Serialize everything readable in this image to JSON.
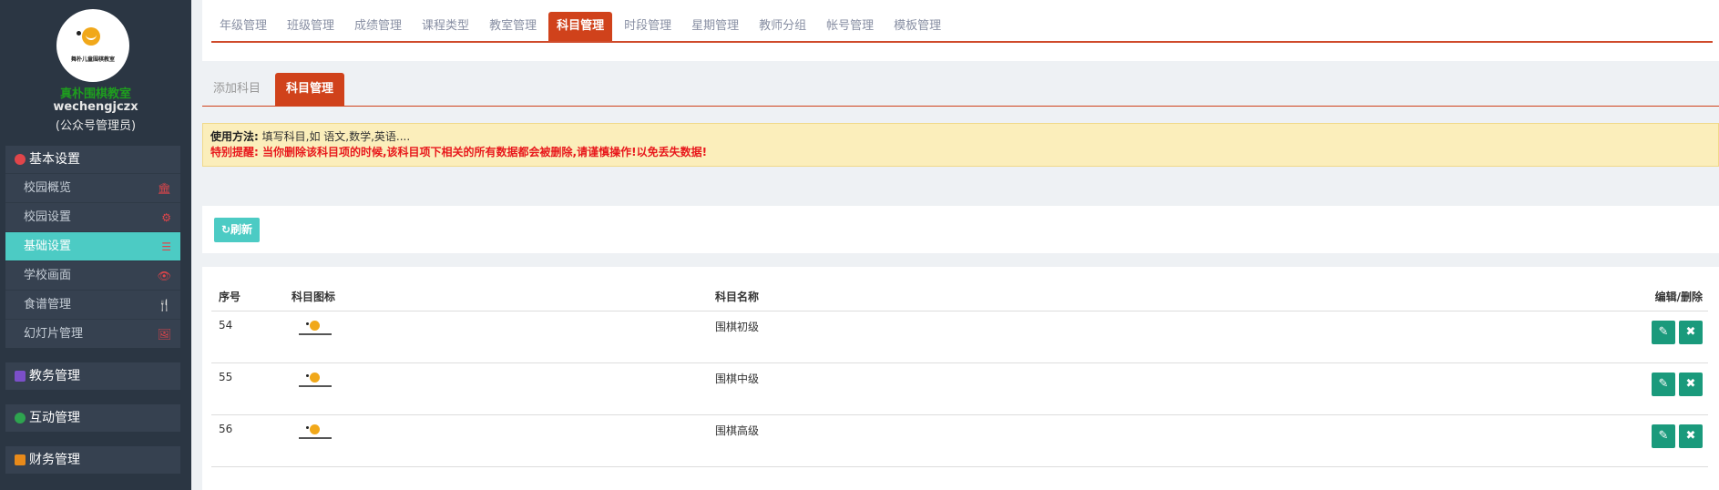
{
  "sidebar": {
    "profile": {
      "logo_text": "舞朴儿童围棋教室",
      "school_name": "真朴围棋教室",
      "username": "wechengjczx",
      "role": "(公众号管理员)"
    },
    "groups": [
      {
        "title": "基本设置",
        "icon": "gear-icon",
        "icon_color": "#e0454a",
        "items": [
          {
            "label": "校园概览",
            "icon": "bank-icon",
            "glyph": "🏛"
          },
          {
            "label": "校园设置",
            "icon": "gear-icon",
            "glyph": "⚙"
          },
          {
            "label": "基础设置",
            "icon": "list-icon",
            "glyph": "☰",
            "active": true
          },
          {
            "label": "学校画面",
            "icon": "eye-icon",
            "glyph": "👁"
          },
          {
            "label": "食谱管理",
            "icon": "cutlery-icon",
            "glyph": "🍴"
          },
          {
            "label": "幻灯片管理",
            "icon": "picture-icon",
            "glyph": "🖼"
          }
        ]
      },
      {
        "title": "教务管理",
        "icon": "database-icon",
        "icon_color": "#7b4fc9"
      },
      {
        "title": "互动管理",
        "icon": "chat-icon",
        "icon_color": "#2ea44f"
      },
      {
        "title": "财务管理",
        "icon": "money-icon",
        "icon_color": "#e88a1a"
      }
    ]
  },
  "top_tabs": [
    "年级管理",
    "班级管理",
    "成绩管理",
    "课程类型",
    "教室管理",
    "科目管理",
    "时段管理",
    "星期管理",
    "教师分组",
    "帐号管理",
    "模板管理"
  ],
  "top_tabs_active": "科目管理",
  "sub_tabs": [
    "添加科目",
    "科目管理"
  ],
  "sub_tabs_active": "科目管理",
  "notice": {
    "label": "使用方法:",
    "usage": "填写科目,如 语文,数学,英语....",
    "warning": "特别提醒: 当你删除该科目项的时候,该科目项下相关的所有数据都会被删除,请谨慎操作!以免丢失数据!"
  },
  "refresh_label": "↻刷新",
  "table": {
    "headers": {
      "id": "序号",
      "icon": "科目图标",
      "name": "科目名称",
      "edit": "编辑/删除"
    },
    "rows": [
      {
        "id": "54",
        "name": "围棋初级"
      },
      {
        "id": "55",
        "name": "围棋中级"
      },
      {
        "id": "56",
        "name": "围棋高级"
      }
    ],
    "edit_icon": "✎",
    "delete_icon": "✖"
  },
  "colors": {
    "accent": "#d0421b",
    "teal": "#4ccbc4",
    "action": "#1a9a7c",
    "warning_text": "#e8181c",
    "sidebar_bg": "#2b3643"
  }
}
